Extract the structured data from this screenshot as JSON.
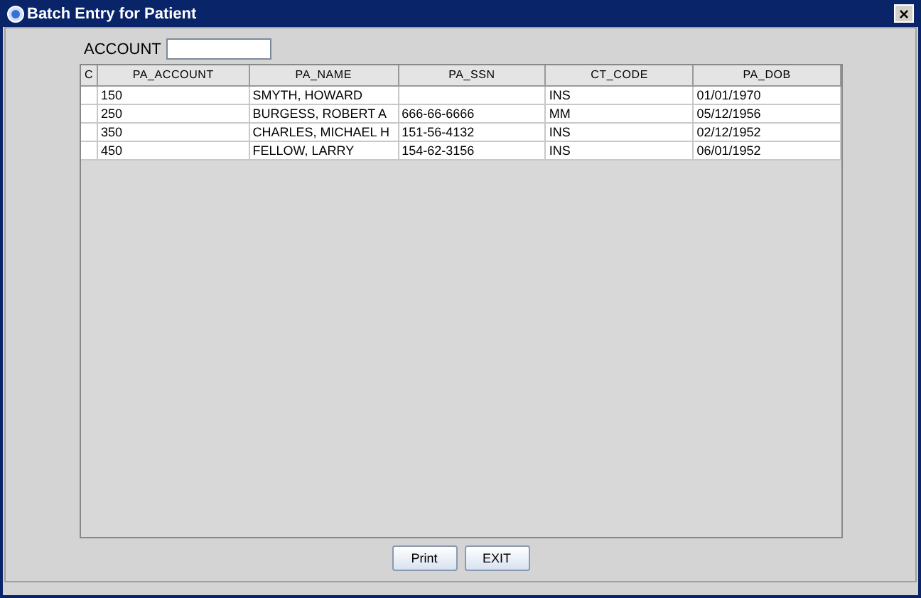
{
  "window": {
    "title": "Batch Entry for Patient",
    "close": "×"
  },
  "account": {
    "label": "ACCOUNT"
  },
  "table": {
    "columns": [
      "C",
      "PA_ACCOUNT",
      "PA_NAME",
      "PA_SSN",
      "CT_CODE",
      "PA_DOB"
    ],
    "rows": [
      [
        null,
        "150",
        "SMYTH, HOWARD",
        null,
        "INS",
        "01/01/1970"
      ],
      [
        null,
        "250",
        "BURGESS, ROBERT A",
        "666-66-6666",
        "MM",
        "05/12/1956"
      ],
      [
        null,
        "350",
        "CHARLES, MICHAEL H",
        "151-56-4132",
        "INS",
        "02/12/1952"
      ],
      [
        null,
        "450",
        "FELLOW, LARRY",
        "154-62-3156",
        "INS",
        "06/01/1952"
      ]
    ]
  },
  "buttons": [
    "Print",
    "EXIT"
  ]
}
